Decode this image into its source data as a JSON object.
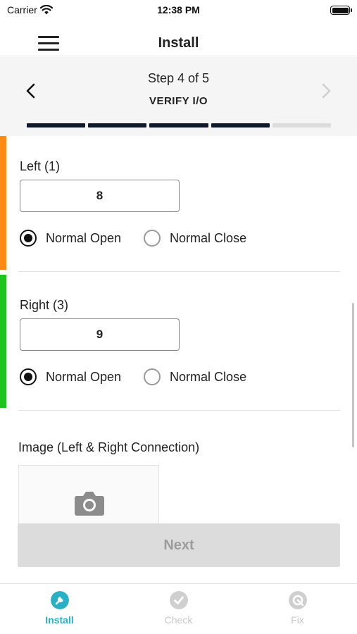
{
  "status_bar": {
    "carrier": "Carrier",
    "time": "12:38 PM"
  },
  "nav": {
    "title": "Install"
  },
  "step": {
    "count_text": "Step 4 of 5",
    "name": "VERIFY I/O",
    "progress_total": 5,
    "progress_completed": 4
  },
  "fields": [
    {
      "label": "Left (1)",
      "value": "8",
      "accent_color": "#ff8a14",
      "options": [
        "Normal Open",
        "Normal Close"
      ],
      "selected": "Normal Open"
    },
    {
      "label": "Right (3)",
      "value": "9",
      "accent_color": "#1ec41e",
      "options": [
        "Normal Open",
        "Normal Close"
      ],
      "selected": "Normal Open"
    }
  ],
  "image_field": {
    "label": "Image (Left & Right Connection)"
  },
  "next_button": {
    "label": "Next"
  },
  "tabs": [
    {
      "label": "Install",
      "icon": "wrench-icon",
      "active": true,
      "color": "#2ab0c5"
    },
    {
      "label": "Check",
      "icon": "checkmark-icon",
      "active": false,
      "color": "#cfcfcf"
    },
    {
      "label": "Fix",
      "icon": "fix-icon",
      "active": false,
      "color": "#cfcfcf"
    }
  ]
}
